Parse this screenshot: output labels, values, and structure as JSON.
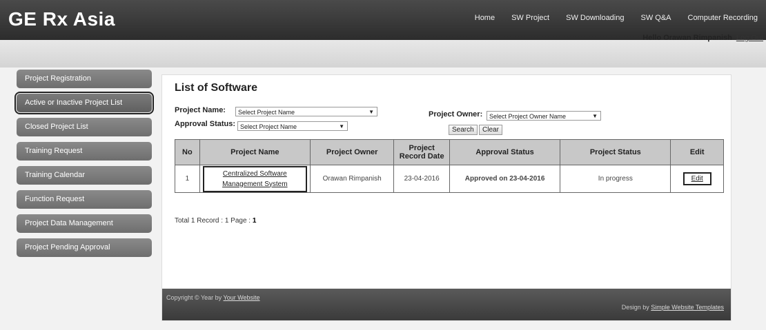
{
  "header": {
    "brand": "GE Rx Asia",
    "nav": [
      "Home",
      "SW Project",
      "SW Downloading",
      "SW Q&A",
      "Computer Recording"
    ],
    "greeting": "Hello Orawan Rimpanish",
    "logout": "Log Out"
  },
  "sidebar": {
    "items": [
      {
        "label": "Project Registration"
      },
      {
        "label": "Active or Inactive Project List"
      },
      {
        "label": "Closed Project List"
      },
      {
        "label": "Training Request"
      },
      {
        "label": "Training Calendar"
      },
      {
        "label": "Function Request"
      },
      {
        "label": "Project Data Management"
      },
      {
        "label": "Project Pending Approval"
      }
    ]
  },
  "main": {
    "title": "List of Software",
    "filters": {
      "project_name_label": "Project Name:",
      "project_name_value": "Select Project Name",
      "approval_status_label": "Approval Status:",
      "approval_status_value": "Select Project Name",
      "project_owner_label": "Project Owner:",
      "project_owner_value": "Select Project Owner Name",
      "search_label": "Search",
      "clear_label": "Clear"
    },
    "table": {
      "headers": {
        "no": "No",
        "project_name": "Project Name",
        "project_owner": "Project Owner",
        "record_date": "Project Record Date",
        "approval_status": "Approval Status",
        "project_status": "Project Status",
        "edit": "Edit"
      },
      "rows": [
        {
          "no": "1",
          "project_name": "Centralized Software Management System",
          "project_owner": "Orawan Rimpanish",
          "record_date": "23-04-2016",
          "approval_status": "Approved on 23-04-2016",
          "project_status": "In progress",
          "edit": "Edit"
        }
      ]
    },
    "pagination": {
      "text": "Total 1 Record : 1 Page : ",
      "current": "1"
    }
  },
  "footer": {
    "left_prefix": "Copyright © Year by ",
    "left_link": "Your Website",
    "right_prefix": "Design by ",
    "right_link": "Simple Website Templates"
  }
}
